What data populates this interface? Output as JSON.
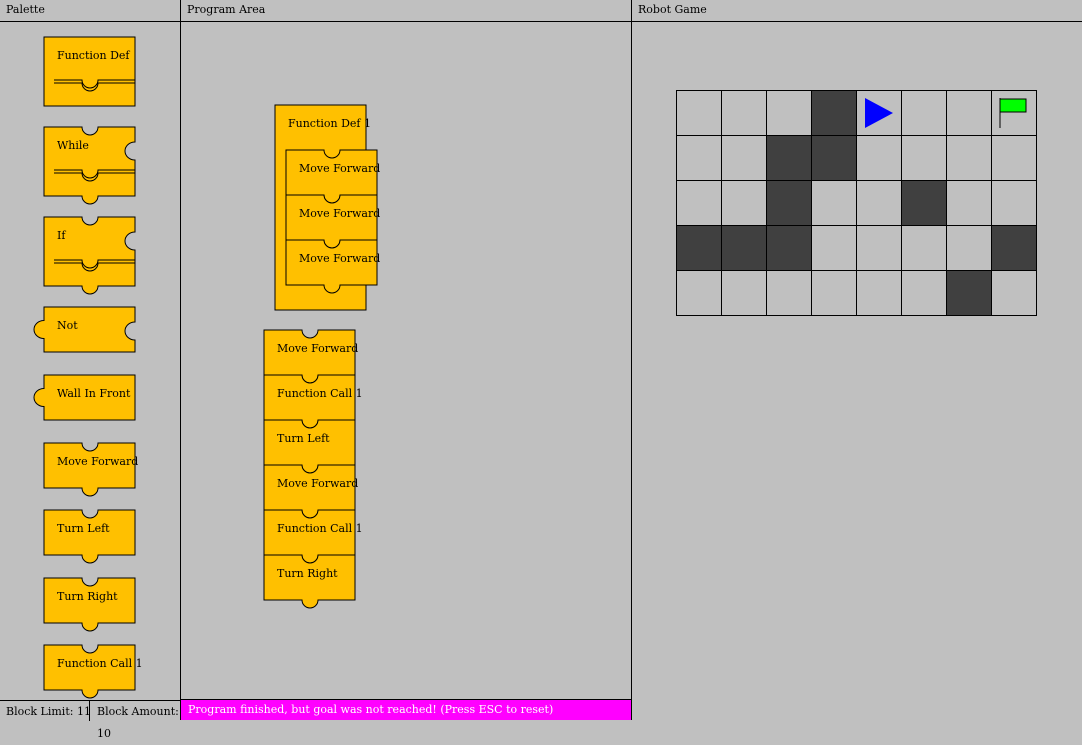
{
  "panels": {
    "palette_title": "Palette",
    "program_title": "Program Area",
    "robot_title": "Robot Game"
  },
  "palette_blocks": [
    {
      "label": "Function Def"
    },
    {
      "label": "While"
    },
    {
      "label": "If"
    },
    {
      "label": "Not"
    },
    {
      "label": "Wall In Front"
    },
    {
      "label": "Move Forward"
    },
    {
      "label": "Turn Left"
    },
    {
      "label": "Turn Right"
    },
    {
      "label": "Function Call 1"
    }
  ],
  "program": {
    "function_def": {
      "label": "Function Def 1",
      "body": [
        "Move Forward",
        "Move Forward",
        "Move Forward"
      ]
    },
    "main_sequence": [
      "Move Forward",
      "Function Call 1",
      "Turn Left",
      "Move Forward",
      "Function Call 1",
      "Turn Right"
    ]
  },
  "status": {
    "block_limit": "Block Limit: 11",
    "block_amount": "Block Amount: 10",
    "message": "Program finished, but goal was not reached! (Press ESC to reset)"
  },
  "robot_game": {
    "rows": 5,
    "cols": 8,
    "walls": [
      [
        0,
        3
      ],
      [
        1,
        2
      ],
      [
        1,
        3
      ],
      [
        2,
        2
      ],
      [
        2,
        5
      ],
      [
        3,
        0
      ],
      [
        3,
        1
      ],
      [
        3,
        2
      ],
      [
        3,
        7
      ],
      [
        4,
        6
      ]
    ],
    "robot": {
      "row": 0,
      "col": 4,
      "direction": "right",
      "icon": "robot-arrow-icon",
      "color": "#0000ff"
    },
    "goal": {
      "row": 0,
      "col": 7,
      "icon": "goal-flag-icon",
      "color": "#00ff00"
    }
  },
  "colors": {
    "block": "#ffc000",
    "wall": "#404040",
    "floor": "#c0c0c0",
    "message_bar": "#ff00ff"
  }
}
